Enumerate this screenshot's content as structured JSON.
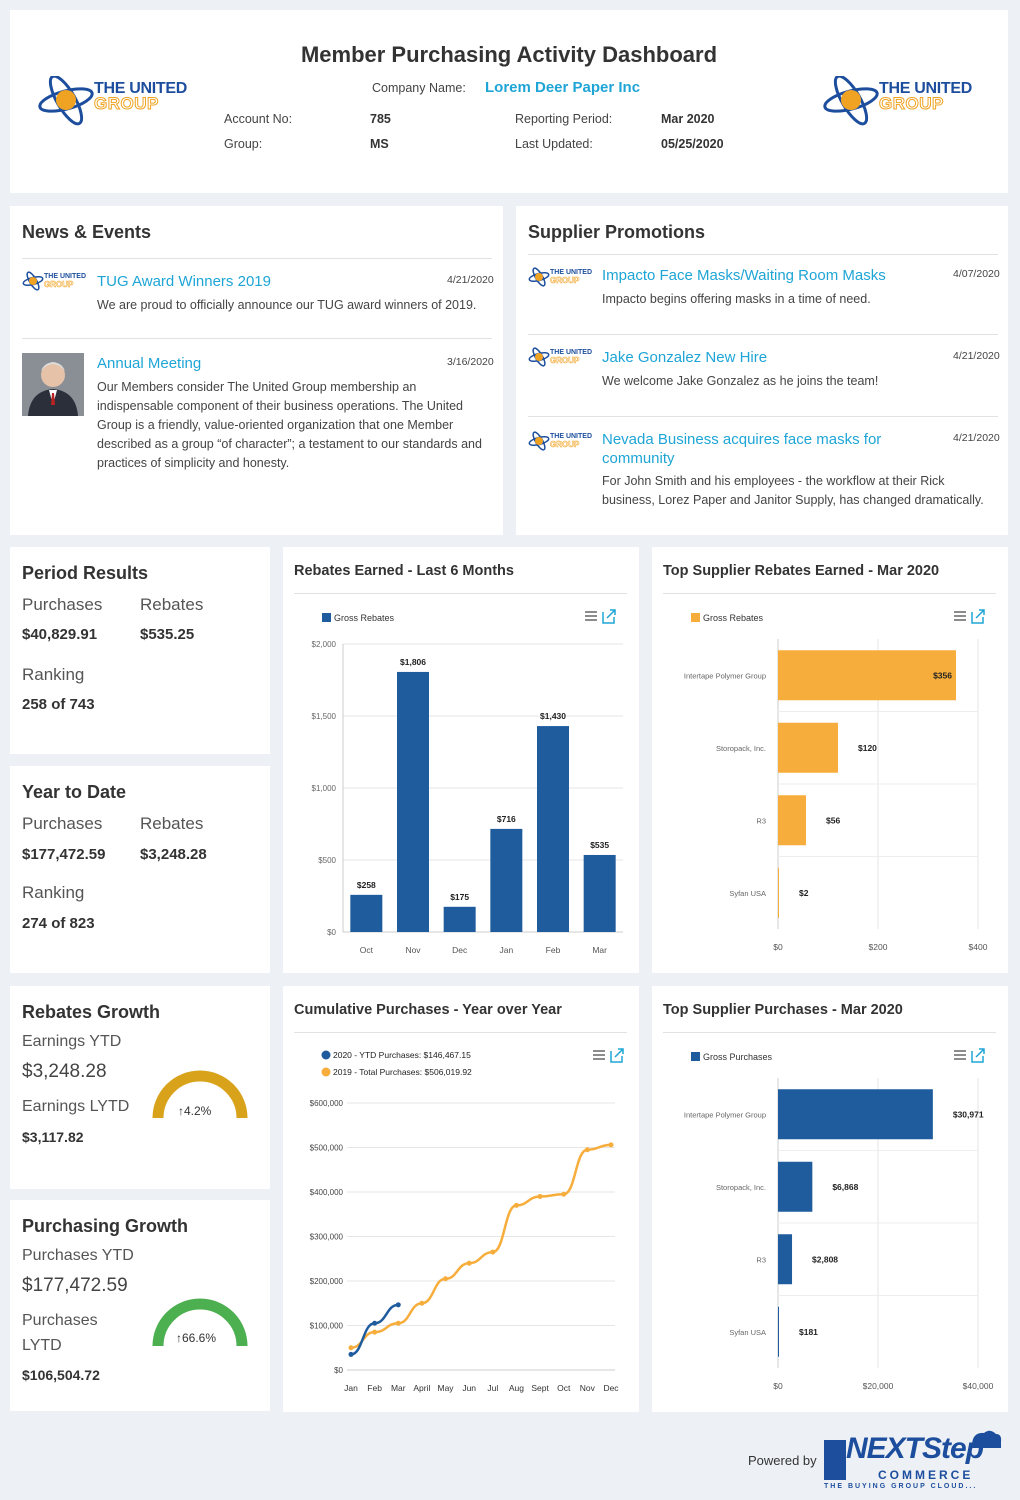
{
  "header": {
    "title": "Member Purchasing Activity Dashboard",
    "logo_line1": "THE UNITED",
    "logo_line2": "GROUP",
    "company_label": "Company Name:",
    "company_value": "Lorem Deer Paper Inc",
    "account_label": "Account No:",
    "account_value": "785",
    "group_label": "Group:",
    "group_value": "MS",
    "period_label": "Reporting Period:",
    "period_value": "Mar 2020",
    "updated_label": "Last Updated:",
    "updated_value": "05/25/2020"
  },
  "news": {
    "title": "News & Events",
    "items": [
      {
        "title": "TUG Award Winners 2019",
        "date": "4/21/2020",
        "text": "We are proud to officially announce our TUG award winners of 2019."
      },
      {
        "title": "Annual Meeting",
        "date": "3/16/2020",
        "text": "Our Members consider The United Group membership an indispensable component of their business operations. The United Group is a friendly, value-oriented organization that one Member described as a group “of character”; a testament to our standards and practices of simplicity and honesty."
      }
    ]
  },
  "promotions": {
    "title": "Supplier Promotions",
    "items": [
      {
        "title": "Impacto Face Masks/Waiting Room Masks",
        "date": "4/07/2020",
        "text": "Impacto begins offering masks in a time of need."
      },
      {
        "title": "Jake Gonzalez New Hire",
        "date": "4/21/2020",
        "text": "We welcome Jake Gonzalez as he joins the team!"
      },
      {
        "title": "Nevada Business acquires face masks for community",
        "date": "4/21/2020",
        "text": "For John Smith and his employees - the workflow at their Rick business, Lorez Paper and Janitor Supply, has changed dramatically."
      }
    ]
  },
  "period": {
    "title": "Period Results",
    "purchases_label": "Purchases",
    "purchases": "$40,829.91",
    "rebates_label": "Rebates",
    "rebates": "$535.25",
    "ranking_label": "Ranking",
    "ranking": "258 of 743"
  },
  "ytd": {
    "title": "Year to Date",
    "purchases_label": "Purchases",
    "purchases": "$177,472.59",
    "rebates_label": "Rebates",
    "rebates": "$3,248.28",
    "ranking_label": "Ranking",
    "ranking": "274 of 823"
  },
  "rebates_growth": {
    "title": "Rebates Growth",
    "ytd_label": "Earnings YTD",
    "ytd": "$3,248.28",
    "lytd_label": "Earnings LYTD",
    "lytd": "$3,117.82",
    "gauge_text": "↑4.2%",
    "gauge_color": "#d9a21b"
  },
  "purchasing_growth": {
    "title": "Purchasing Growth",
    "ytd_label": "Purchases YTD",
    "ytd": "$177,472.59",
    "lytd_label_1": "Purchases",
    "lytd_label_2": "LYTD",
    "lytd": "$106,504.72",
    "gauge_text": "↑66.6%",
    "gauge_color": "#4caf50"
  },
  "footer": {
    "powered_by": "Powered by",
    "brand_1": "NEXTStep",
    "brand_2": "COMMERCE",
    "brand_3": "THE BUYING GROUP CLOUD..."
  },
  "chart_data": [
    {
      "type": "bar",
      "title": "Rebates Earned - Last 6 Months",
      "legend": "Gross Rebates",
      "color": "#1f5c9e",
      "categories": [
        "Oct",
        "Nov",
        "Dec",
        "Jan",
        "Feb",
        "Mar"
      ],
      "values": [
        258,
        1806,
        175,
        716,
        1430,
        535
      ],
      "value_labels": [
        "$258",
        "$1,806",
        "$175",
        "$716",
        "$1,430",
        "$535"
      ],
      "ylim": [
        0,
        2000
      ],
      "yticks": [
        "$0",
        "$500",
        "$1,000",
        "$1,500",
        "$2,000"
      ]
    },
    {
      "type": "bar",
      "orientation": "horizontal",
      "title": "Top Supplier Rebates Earned - Mar 2020",
      "legend": "Gross Rebates",
      "color": "#f7ad3b",
      "categories": [
        "Intertape Polymer Group",
        "Storopack, Inc.",
        "R3",
        "Syfan USA"
      ],
      "values": [
        356,
        120,
        56,
        2
      ],
      "value_labels": [
        "$356",
        "$120",
        "$56",
        "$2"
      ],
      "xlim": [
        0,
        400
      ],
      "xticks": [
        "$0",
        "$200",
        "$400"
      ]
    },
    {
      "type": "line",
      "title": "Cumulative Purchases - Year over Year",
      "x": [
        "Jan",
        "Feb",
        "Mar",
        "April",
        "May",
        "Jun",
        "Jul",
        "Aug",
        "Sept",
        "Oct",
        "Nov",
        "Dec"
      ],
      "series": [
        {
          "name": "2020",
          "legend_text": "YTD Purchases: $146,467.15",
          "color": "#1f5c9e",
          "values": [
            35000,
            105000,
            146467
          ]
        },
        {
          "name": "2019",
          "legend_text": "Total Purchases: $506,019.92",
          "color": "#f7ad3b",
          "values": [
            50000,
            85000,
            105000,
            150000,
            205000,
            240000,
            265000,
            370000,
            390000,
            395000,
            495000,
            506020
          ]
        }
      ],
      "ylim": [
        0,
        600000
      ],
      "yticks": [
        "$0",
        "$100,000",
        "$200,000",
        "$300,000",
        "$400,000",
        "$500,000",
        "$600,000"
      ]
    },
    {
      "type": "bar",
      "orientation": "horizontal",
      "title": "Top Supplier Purchases - Mar 2020",
      "legend": "Gross Purchases",
      "color": "#1f5c9e",
      "categories": [
        "Intertape Polymer Group",
        "Storopack, Inc.",
        "R3",
        "Syfan USA"
      ],
      "values": [
        30971,
        6868,
        2808,
        181
      ],
      "value_labels": [
        "$30,971",
        "$6,868",
        "$2,808",
        "$181"
      ],
      "xlim": [
        0,
        40000
      ],
      "xticks": [
        "$0",
        "$20,000",
        "$40,000"
      ]
    }
  ]
}
